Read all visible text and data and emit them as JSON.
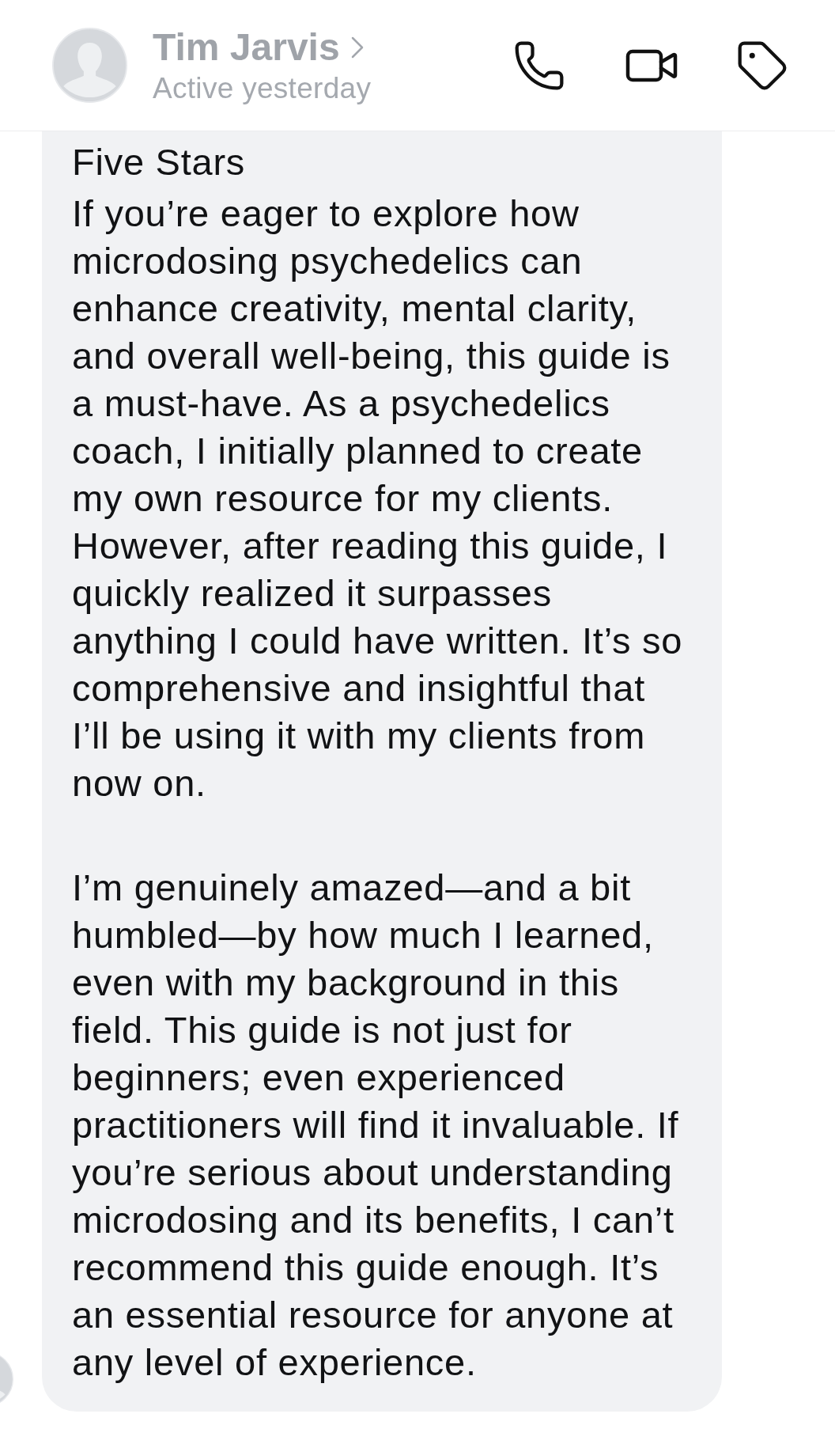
{
  "header": {
    "contact": {
      "name": "Tim Jarvis",
      "status": "Active yesterday"
    }
  },
  "message": {
    "title": "Five Stars",
    "paragraphs": [
      "If you’re eager to explore how microdosing psychedelics can enhance creativity, mental clarity, and overall well-being, this guide is a must-have. As a psychedelics coach, I initially planned to create my own resource for my clients. However, after reading this guide, I quickly realized it surpasses anything I could have written. It’s so comprehensive and insightful that I’ll be using it with my clients from now on.",
      "I’m genuinely amazed—and a bit humbled—by how much I learned, even with my background in this field. This guide is not just for beginners; even experienced practitioners will find it invaluable. If you’re serious about understanding microdosing and its benefits, I can’t recommend this guide enough. It’s an essential resource for anyone at any level of experience."
    ]
  }
}
